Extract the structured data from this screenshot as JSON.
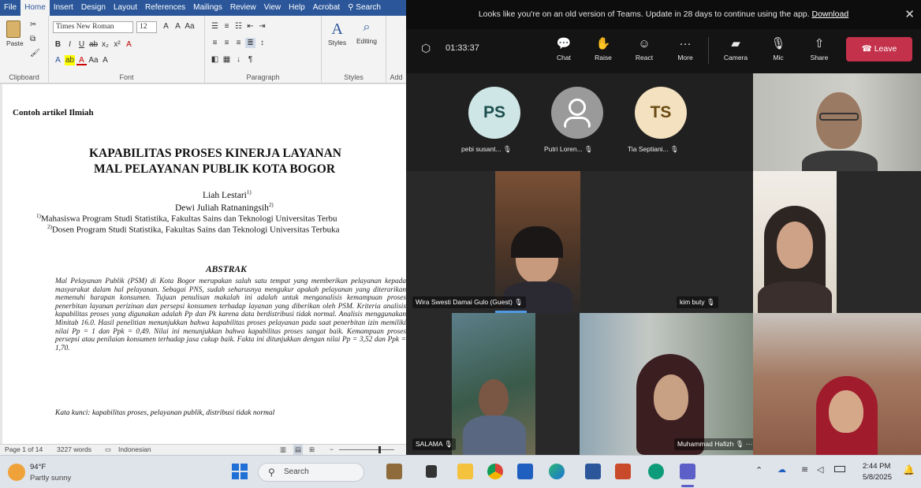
{
  "word": {
    "menu_tabs": [
      "File",
      "Home",
      "Insert",
      "Design",
      "Layout",
      "References",
      "Mailings",
      "Review",
      "View",
      "Help",
      "Acrobat",
      "Search"
    ],
    "ribbon": {
      "font_name": "Times New Roman",
      "font_size": "12",
      "paste_label": "Paste",
      "styles_label": "Styles",
      "editing_label": "Editing",
      "groups": [
        "Clipboard",
        "Font",
        "Paragraph",
        "Styles",
        "Add"
      ]
    },
    "document": {
      "heading_note": "Contoh artikel Ilmiah",
      "title_line1": "KAPABILITAS PROSES KINERJA LAYANAN",
      "title_line2": "MAL PELAYANAN PUBLIK KOTA BOGOR",
      "author1": "Liah Lestari",
      "author1_sup": "1)",
      "author2": "Dewi Juliah Ratnaningsih",
      "author2_sup": "2)",
      "affil1_sup": "1)",
      "affil1": "Mahasiswa Program Studi Statistika, Fakultas Sains dan Teknologi Universitas Terbu",
      "affil2_sup": "2)",
      "affil2": "Dosen Program Studi Statistika, Fakultas Sains dan Teknologi Universitas Terbuka",
      "abstract_heading": "ABSTRAK",
      "abstract_text": "Mal Pelayanan Publik (PSM) di Kota Bogor merupakan salah satu tempat yang memberikan pelayanan kepada masyarakat dalam hal pelayanan. Sebagai PNS, sudah seharusnya mengukur apakah pelayanan yang diterarikan memenuhi harapan konsumen. Tujuan penulisan makalah ini adalah untuk menganalisis kemampuan proses penerbitan layanan perizinan dan persepsi konsumen terhadap layanan yang diberikan oleh PSM. Kriteria analisis kapabilitas proses yang digunakan adalah Pp dan Pk karena data berdistribusi tidak normal. Analisis menggunakan Minitab 16.0. Hasil penelitian menunjukkan bahwa kapabilitas proses pelayanan pada saat penerbitan izin memiliki nilai Pp = 1 dan Ppk = 0,49. Nilai ini menunjukkan bahwa kapabilitas proses sangat baik. Kemampuan proses persepsi atau penilaian konsumen terhadap jasa cukup baik. Fakta ini ditunjukkan dengan nilai Pp = 3,52 dan Ppk = 1,70.",
      "keywords": "Kata kunci: kapabilitas proses, pelayanan publik, distribusi tidak normal"
    },
    "status": {
      "page": "Page 1 of 14",
      "words": "3227 words",
      "language": "Indonesian"
    }
  },
  "teams": {
    "banner_text": "Looks like you're on an old version of Teams. Update in 28 days to continue using the app.",
    "banner_link": "Download",
    "timer": "01:33:37",
    "toolbar": {
      "chat": "Chat",
      "raise": "Raise",
      "react": "React",
      "more": "More",
      "camera": "Camera",
      "mic": "Mic",
      "share": "Share",
      "leave": "Leave"
    },
    "avatars": [
      {
        "initials": "PS",
        "name": "pebi susant...",
        "color": "#cfe6e6"
      },
      {
        "initials": "",
        "name": "Putri Loren...",
        "color": "#9a9a9a"
      },
      {
        "initials": "TS",
        "name": "Tia Septiani...",
        "color": "#f3e1bf"
      }
    ],
    "participants": {
      "p1": "Wira Swesti Damai Gulo (Guest)",
      "p2": "kim buty",
      "p3": "SALAMA",
      "p4": "Muhammad Hafizh"
    },
    "leave_color": "#c4314b"
  },
  "taskbar": {
    "weather_temp": "94°F",
    "weather_desc": "Partly sunny",
    "search_placeholder": "Search",
    "time": "2:44 PM",
    "date": "5/8/2025"
  }
}
